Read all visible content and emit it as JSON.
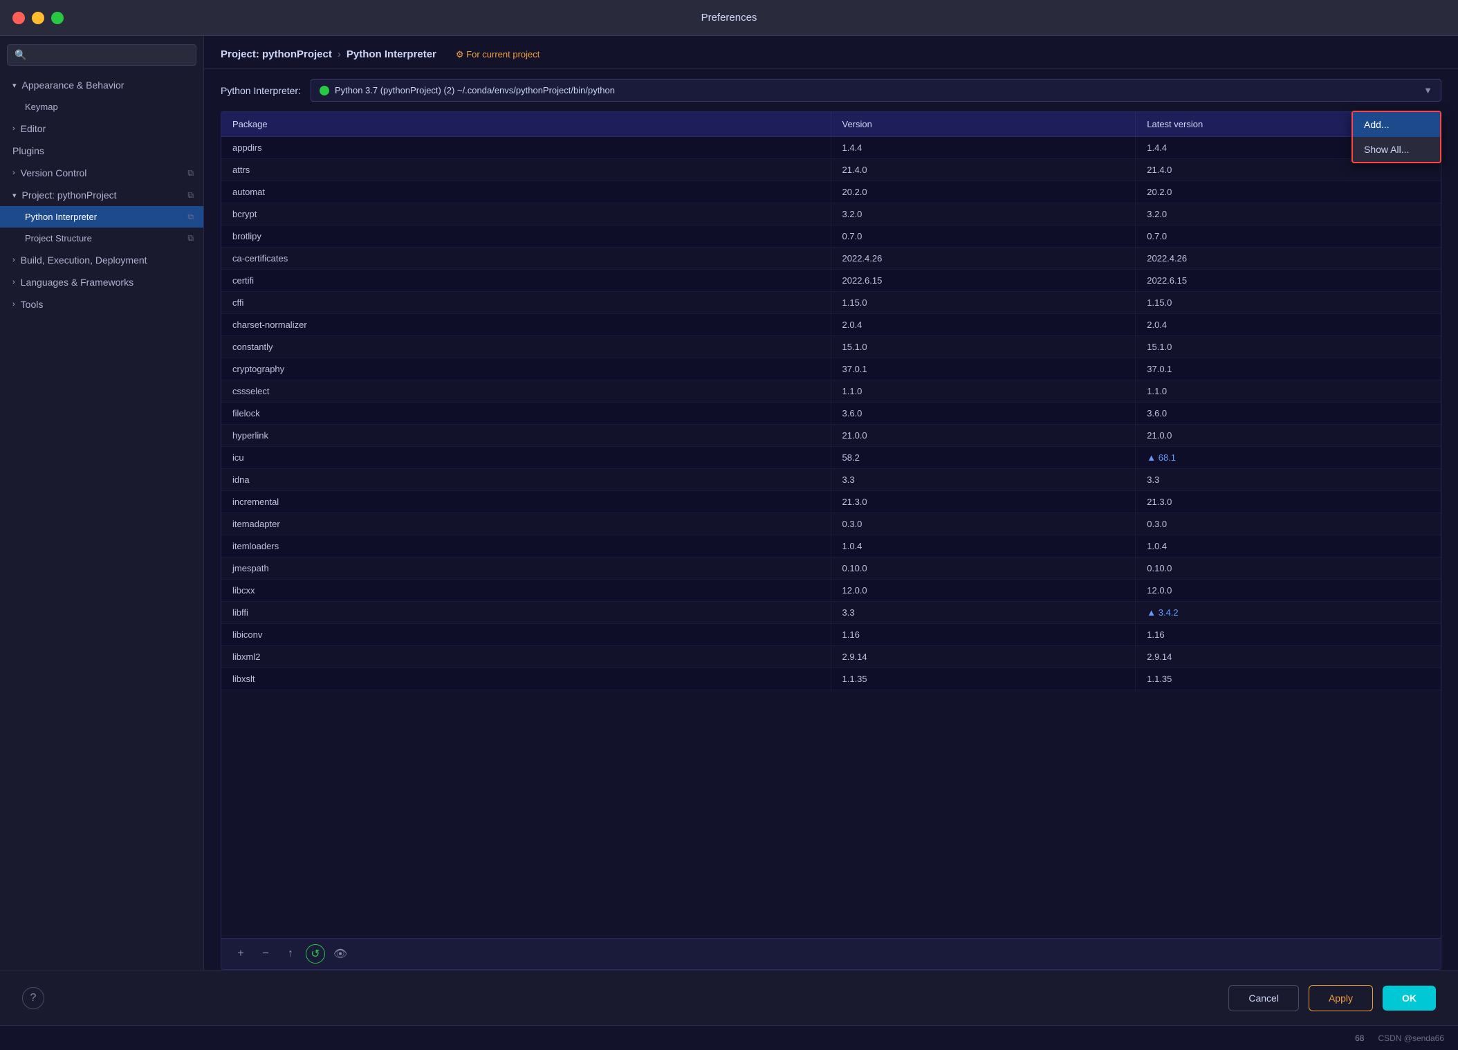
{
  "titlebar": {
    "title": "Preferences"
  },
  "sidebar": {
    "search_placeholder": "🔍",
    "items": [
      {
        "id": "appearance",
        "label": "Appearance & Behavior",
        "type": "parent",
        "expanded": true
      },
      {
        "id": "keymap",
        "label": "Keymap",
        "type": "child"
      },
      {
        "id": "editor",
        "label": "Editor",
        "type": "parent",
        "expanded": false
      },
      {
        "id": "plugins",
        "label": "Plugins",
        "type": "top"
      },
      {
        "id": "version-control",
        "label": "Version Control",
        "type": "parent",
        "expanded": false
      },
      {
        "id": "project",
        "label": "Project: pythonProject",
        "type": "parent",
        "expanded": true
      },
      {
        "id": "python-interpreter",
        "label": "Python Interpreter",
        "type": "child",
        "active": true
      },
      {
        "id": "project-structure",
        "label": "Project Structure",
        "type": "child"
      },
      {
        "id": "build",
        "label": "Build, Execution, Deployment",
        "type": "parent",
        "expanded": false
      },
      {
        "id": "languages",
        "label": "Languages & Frameworks",
        "type": "parent",
        "expanded": false
      },
      {
        "id": "tools",
        "label": "Tools",
        "type": "parent",
        "expanded": false
      }
    ]
  },
  "content": {
    "breadcrumb": {
      "project": "Project: pythonProject",
      "arrow": "›",
      "current": "Python Interpreter",
      "link": "⚙ For current project"
    },
    "interpreter_label": "Python Interpreter:",
    "interpreter_value": "🟢 Python 3.7 (pythonProject) (2) ~/.conda/envs/pythonProject/bin/python",
    "add_button": "Add...",
    "show_all_button": "Show All...",
    "table": {
      "headers": [
        "Package",
        "Version",
        "Latest version"
      ],
      "rows": [
        {
          "package": "appdirs",
          "version": "1.4.4",
          "latest": "1.4.4",
          "upgrade": false
        },
        {
          "package": "attrs",
          "version": "21.4.0",
          "latest": "21.4.0",
          "upgrade": false
        },
        {
          "package": "automat",
          "version": "20.2.0",
          "latest": "20.2.0",
          "upgrade": false
        },
        {
          "package": "bcrypt",
          "version": "3.2.0",
          "latest": "3.2.0",
          "upgrade": false
        },
        {
          "package": "brotlipy",
          "version": "0.7.0",
          "latest": "0.7.0",
          "upgrade": false
        },
        {
          "package": "ca-certificates",
          "version": "2022.4.26",
          "latest": "2022.4.26",
          "upgrade": false
        },
        {
          "package": "certifi",
          "version": "2022.6.15",
          "latest": "2022.6.15",
          "upgrade": false
        },
        {
          "package": "cffi",
          "version": "1.15.0",
          "latest": "1.15.0",
          "upgrade": false
        },
        {
          "package": "charset-normalizer",
          "version": "2.0.4",
          "latest": "2.0.4",
          "upgrade": false
        },
        {
          "package": "constantly",
          "version": "15.1.0",
          "latest": "15.1.0",
          "upgrade": false
        },
        {
          "package": "cryptography",
          "version": "37.0.1",
          "latest": "37.0.1",
          "upgrade": false
        },
        {
          "package": "cssselect",
          "version": "1.1.0",
          "latest": "1.1.0",
          "upgrade": false
        },
        {
          "package": "filelock",
          "version": "3.6.0",
          "latest": "3.6.0",
          "upgrade": false
        },
        {
          "package": "hyperlink",
          "version": "21.0.0",
          "latest": "21.0.0",
          "upgrade": false
        },
        {
          "package": "icu",
          "version": "58.2",
          "latest": "▲ 68.1",
          "upgrade": true
        },
        {
          "package": "idna",
          "version": "3.3",
          "latest": "3.3",
          "upgrade": false
        },
        {
          "package": "incremental",
          "version": "21.3.0",
          "latest": "21.3.0",
          "upgrade": false
        },
        {
          "package": "itemadapter",
          "version": "0.3.0",
          "latest": "0.3.0",
          "upgrade": false
        },
        {
          "package": "itemloaders",
          "version": "1.0.4",
          "latest": "1.0.4",
          "upgrade": false
        },
        {
          "package": "jmespath",
          "version": "0.10.0",
          "latest": "0.10.0",
          "upgrade": false
        },
        {
          "package": "libcxx",
          "version": "12.0.0",
          "latest": "12.0.0",
          "upgrade": false
        },
        {
          "package": "libffi",
          "version": "3.3",
          "latest": "▲ 3.4.2",
          "upgrade": true
        },
        {
          "package": "libiconv",
          "version": "1.16",
          "latest": "1.16",
          "upgrade": false
        },
        {
          "package": "libxml2",
          "version": "2.9.14",
          "latest": "2.9.14",
          "upgrade": false
        },
        {
          "package": "libxslt",
          "version": "1.1.35",
          "latest": "1.1.35",
          "upgrade": false
        }
      ]
    },
    "toolbar": {
      "add": "+",
      "remove": "−",
      "up": "↑",
      "refresh": "↺",
      "eye": "👁"
    }
  },
  "bottom": {
    "help": "?",
    "cancel": "Cancel",
    "apply": "Apply",
    "ok": "OK"
  },
  "statusbar": {
    "line": "68",
    "brand": "CSDN @senda66"
  }
}
